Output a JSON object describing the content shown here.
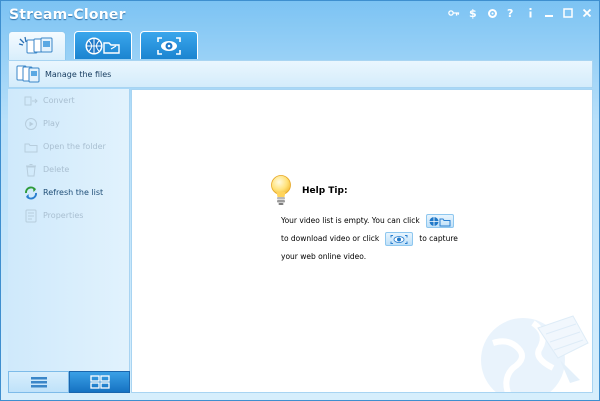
{
  "window": {
    "title": "Stream-Cloner"
  },
  "titlebar_icons": [
    {
      "name": "key-icon"
    },
    {
      "name": "dollar-icon"
    },
    {
      "name": "settings-icon"
    },
    {
      "name": "help-icon"
    },
    {
      "name": "info-icon"
    },
    {
      "name": "minimize-icon"
    },
    {
      "name": "maximize-icon"
    },
    {
      "name": "close-icon"
    }
  ],
  "tabs": [
    {
      "icon": "video-files-icon",
      "active": true
    },
    {
      "icon": "globe-folder-icon",
      "active": false
    },
    {
      "icon": "capture-eye-icon",
      "active": false
    }
  ],
  "toolbar": {
    "label": "Manage the files",
    "icon": "files-icon"
  },
  "sidebar": {
    "items": [
      {
        "label": "Convert",
        "icon": "convert-icon",
        "enabled": false
      },
      {
        "label": "Play",
        "icon": "play-icon",
        "enabled": false
      },
      {
        "label": "Open the folder",
        "icon": "folder-icon",
        "enabled": false
      },
      {
        "label": "Delete",
        "icon": "delete-icon",
        "enabled": false
      },
      {
        "label": "Refresh the list",
        "icon": "refresh-icon",
        "enabled": true
      },
      {
        "label": "Properties",
        "icon": "properties-icon",
        "enabled": false
      }
    ]
  },
  "view_buttons": {
    "list": "list-view-icon",
    "grid": "grid-view-icon",
    "active": "grid"
  },
  "help": {
    "title": "Help Tip:",
    "line1_before": "Your video list is empty. You can click",
    "line2_before": "to download video or click",
    "line2_after": "to capture",
    "line3": "your web online video."
  },
  "colors": {
    "accent": "#1b84d0",
    "frame": "#7cc3f3",
    "panel": "#d6eefc"
  }
}
